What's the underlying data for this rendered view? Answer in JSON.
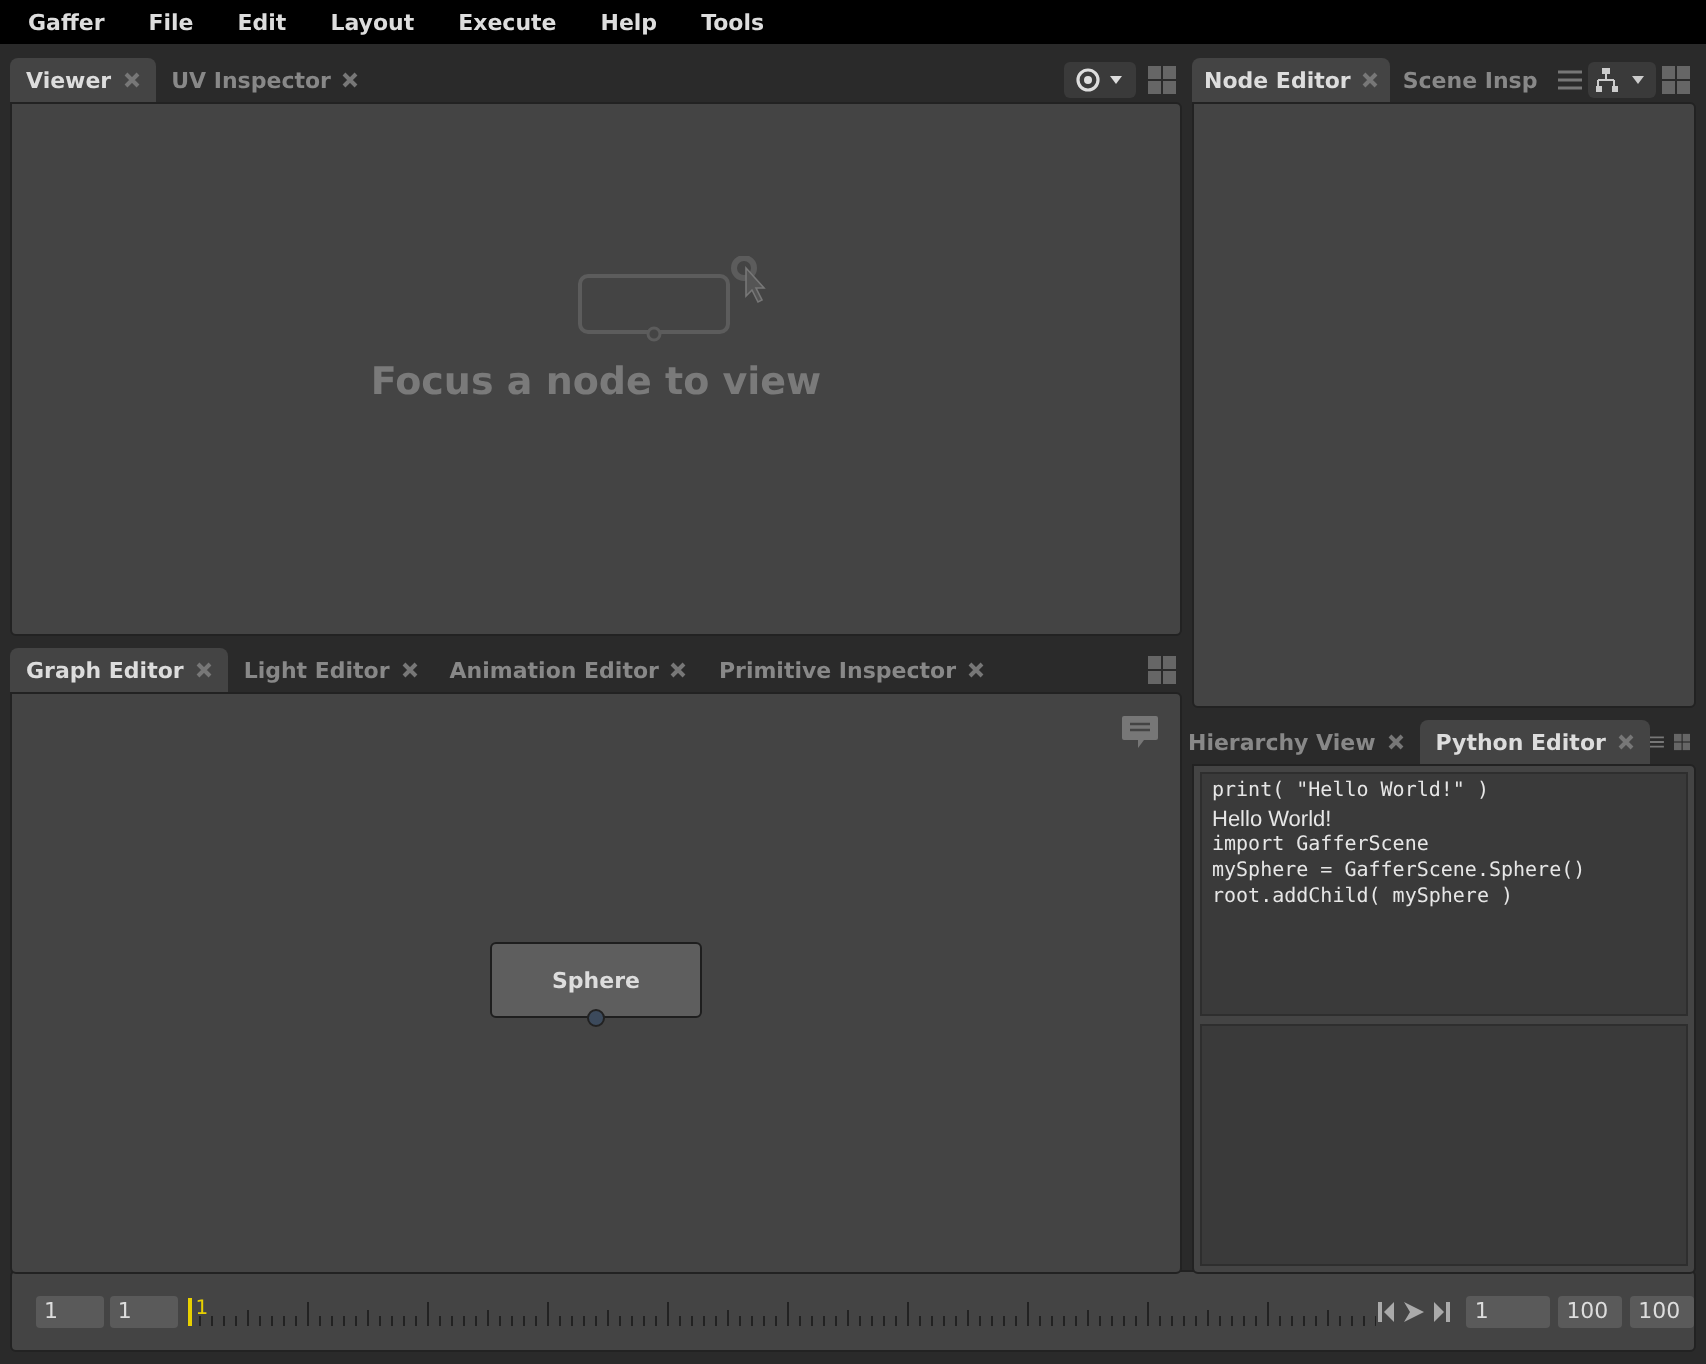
{
  "menu": [
    "Gaffer",
    "File",
    "Edit",
    "Layout",
    "Execute",
    "Help",
    "Tools"
  ],
  "viewer_panel": {
    "tabs": [
      {
        "label": "Viewer",
        "selected": true
      },
      {
        "label": "UV Inspector",
        "selected": false
      }
    ],
    "message": "Focus a node to view"
  },
  "graph_panel": {
    "tabs": [
      {
        "label": "Graph Editor",
        "selected": true
      },
      {
        "label": "Light Editor",
        "selected": false
      },
      {
        "label": "Animation Editor",
        "selected": false
      },
      {
        "label": "Primitive Inspector",
        "selected": false
      }
    ],
    "node": {
      "label": "Sphere"
    }
  },
  "node_editor_panel": {
    "tabs": [
      {
        "label": "Node Editor",
        "selected": true
      },
      {
        "label": "Scene Insp",
        "selected": false
      }
    ]
  },
  "python_panel": {
    "tabs": [
      {
        "label": "Hierarchy View",
        "selected": false
      },
      {
        "label": "Python Editor",
        "selected": true
      }
    ],
    "output": [
      {
        "kind": "code",
        "text": "print( \"Hello World!\" )"
      },
      {
        "kind": "output",
        "text": "Hello World!"
      },
      {
        "kind": "code",
        "text": "import GafferScene"
      },
      {
        "kind": "code",
        "text": "mySphere = GafferScene.Sphere()"
      },
      {
        "kind": "code",
        "text": "root.addChild( mySphere )"
      }
    ]
  },
  "timeline": {
    "start_fields": [
      "1",
      "1"
    ],
    "current_frame": "1",
    "level": 0,
    "frame_field": "1",
    "end_fields": [
      "100",
      "100"
    ]
  }
}
